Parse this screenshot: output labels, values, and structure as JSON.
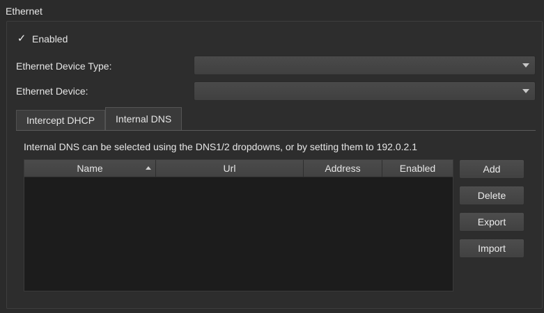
{
  "section": {
    "title": "Ethernet"
  },
  "enabled": {
    "checked": true,
    "check_glyph": "✓",
    "label": "Enabled"
  },
  "device_type": {
    "label": "Ethernet Device Type:",
    "value": ""
  },
  "device": {
    "label": "Ethernet Device:",
    "value": ""
  },
  "tabs": [
    {
      "label": "Intercept DHCP",
      "active": false
    },
    {
      "label": "Internal DNS",
      "active": true
    }
  ],
  "dns": {
    "info": "Internal DNS can be selected using the DNS1/2 dropdowns, or by setting them to 192.0.2.1",
    "columns": [
      "Name",
      "Url",
      "Address",
      "Enabled"
    ],
    "sort_column": "Name",
    "sort_direction": "ascending",
    "rows": []
  },
  "buttons": {
    "add": "Add",
    "delete": "Delete",
    "export": "Export",
    "import": "Import"
  }
}
